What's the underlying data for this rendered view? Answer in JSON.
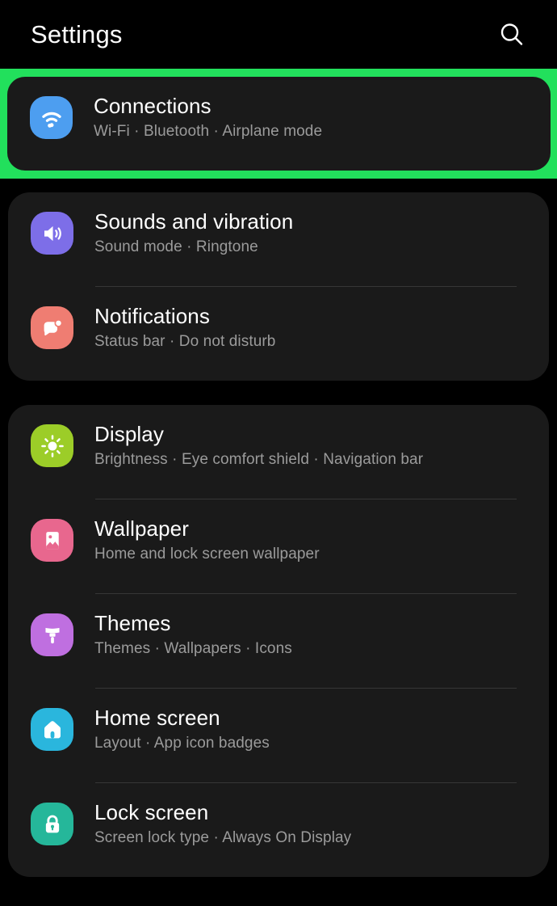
{
  "header": {
    "title": "Settings",
    "search_icon": "search-icon"
  },
  "highlight": {
    "color": "#22e05c",
    "target": "Connections"
  },
  "colors": {
    "page_bg": "#000000",
    "card_bg": "#1a1a1a",
    "title": "#ffffff",
    "subtitle": "#9b9b9b",
    "divider": "#363636"
  },
  "groups": [
    {
      "id": "group-connections",
      "highlighted": true,
      "items": [
        {
          "id": "connections",
          "title": "Connections",
          "subtitle_parts": [
            "Wi-Fi",
            "Bluetooth",
            "Airplane mode"
          ],
          "subtitle": "Wi-Fi  ·  Bluetooth  ·  Airplane mode",
          "icon": "wifi-icon",
          "icon_bg": "#4d9ef0"
        }
      ]
    },
    {
      "id": "group-sound-notifications",
      "highlighted": false,
      "items": [
        {
          "id": "sounds-and-vibration",
          "title": "Sounds and vibration",
          "subtitle_parts": [
            "Sound mode",
            "Ringtone"
          ],
          "subtitle": "Sound mode  ·  Ringtone",
          "icon": "speaker-icon",
          "icon_bg": "#7d6ee8"
        },
        {
          "id": "notifications",
          "title": "Notifications",
          "subtitle_parts": [
            "Status bar",
            "Do not disturb"
          ],
          "subtitle": "Status bar  ·  Do not disturb",
          "icon": "notification-bubble-icon",
          "icon_bg": "#ef7d72"
        }
      ]
    },
    {
      "id": "group-display",
      "highlighted": false,
      "items": [
        {
          "id": "display",
          "title": "Display",
          "subtitle_parts": [
            "Brightness",
            "Eye comfort shield",
            "Navigation bar"
          ],
          "subtitle": "Brightness  ·  Eye comfort shield  ·  Navigation bar",
          "icon": "sun-icon",
          "icon_bg": "#9ccd28"
        },
        {
          "id": "wallpaper",
          "title": "Wallpaper",
          "subtitle_parts": [
            "Home and lock screen wallpaper"
          ],
          "subtitle": "Home and lock screen wallpaper",
          "icon": "image-icon",
          "icon_bg": "#e8678e"
        },
        {
          "id": "themes",
          "title": "Themes",
          "subtitle_parts": [
            "Themes",
            "Wallpapers",
            "Icons"
          ],
          "subtitle": "Themes  ·  Wallpapers  ·  Icons",
          "icon": "paintbrush-icon",
          "icon_bg": "#bf6fe0"
        },
        {
          "id": "home-screen",
          "title": "Home screen",
          "subtitle_parts": [
            "Layout",
            "App icon badges"
          ],
          "subtitle": "Layout  ·  App icon badges",
          "icon": "house-icon",
          "icon_bg": "#2ab6dd"
        },
        {
          "id": "lock-screen",
          "title": "Lock screen",
          "subtitle_parts": [
            "Screen lock type",
            "Always On Display"
          ],
          "subtitle": "Screen lock type  ·  Always On Display",
          "icon": "padlock-icon",
          "icon_bg": "#25b79a"
        }
      ]
    }
  ]
}
